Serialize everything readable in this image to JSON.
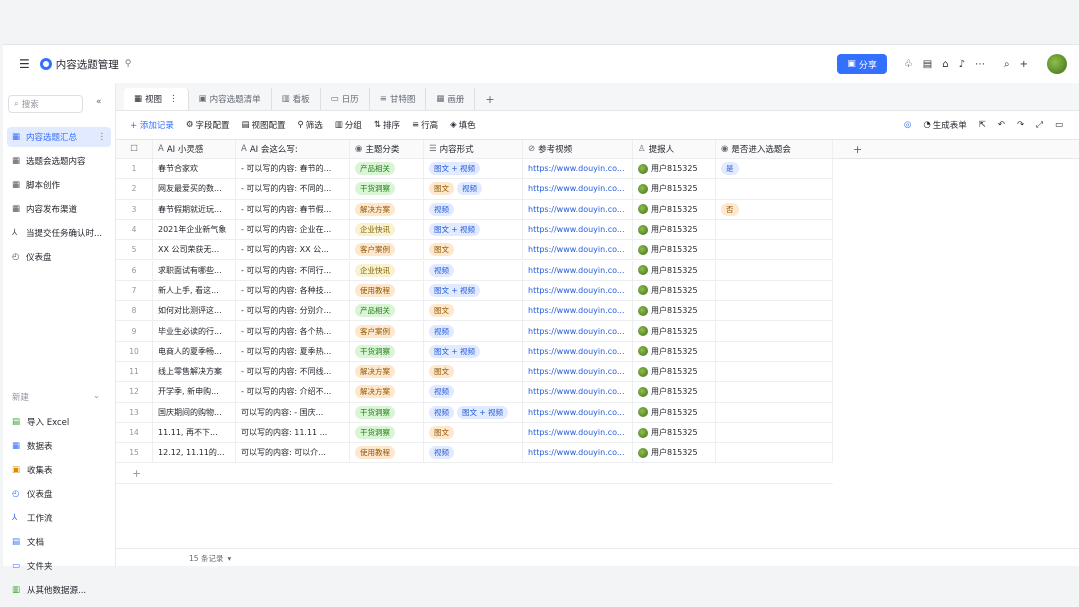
{
  "header": {
    "title": "内容选题管理",
    "share_label": "分享"
  },
  "sidebar": {
    "search_placeholder": "搜索",
    "items": [
      {
        "label": "内容选题汇总",
        "icon": "grid-icon",
        "active": true
      },
      {
        "label": "选题会选题内容",
        "icon": "grid-icon"
      },
      {
        "label": "脚本创作",
        "icon": "grid-icon"
      },
      {
        "label": "内容发布渠道",
        "icon": "grid-icon"
      },
      {
        "label": "当提交任务确认时...",
        "icon": "workflow-icon"
      },
      {
        "label": "仪表盘",
        "icon": "dashboard-icon"
      }
    ],
    "new_header": "新建",
    "new_items": [
      {
        "label": "导入 Excel",
        "icon": "excel-icon",
        "color": "#2ea121"
      },
      {
        "label": "数据表",
        "icon": "table-icon",
        "color": "#3370ff"
      },
      {
        "label": "收集表",
        "icon": "form-icon",
        "color": "#de8c00"
      },
      {
        "label": "仪表盘",
        "icon": "dashboard-icon",
        "color": "#3370ff"
      },
      {
        "label": "工作流",
        "icon": "workflow-icon",
        "color": "#3370ff"
      },
      {
        "label": "文档",
        "icon": "doc-icon",
        "color": "#3370ff"
      },
      {
        "label": "文件夹",
        "icon": "folder-icon",
        "color": "#3370ff"
      },
      {
        "label": "从其他数据源...",
        "icon": "datasource-icon",
        "color": "#2ea121"
      }
    ]
  },
  "tabs": [
    {
      "label": "视图",
      "icon": "grid-icon",
      "active": true
    },
    {
      "label": "内容选题清单",
      "icon": "form-icon"
    },
    {
      "label": "看板",
      "icon": "kanban-icon"
    },
    {
      "label": "日历",
      "icon": "calendar-icon"
    },
    {
      "label": "甘特图",
      "icon": "gantt-icon"
    },
    {
      "label": "画册",
      "icon": "gallery-icon"
    }
  ],
  "toolbar": {
    "add_record": "+ 添加记录",
    "tools": [
      "字段配置",
      "视图配置",
      "筛选",
      "分组",
      "排序",
      "行高",
      "填色"
    ],
    "generate_form": "生成表单"
  },
  "columns": [
    {
      "label": "",
      "icon": "checkbox-icon"
    },
    {
      "label": "AI 小灵感",
      "icon": "ai-icon"
    },
    {
      "label": "AI 会这么写:",
      "icon": "ai-icon"
    },
    {
      "label": "主题分类",
      "icon": "select-icon"
    },
    {
      "label": "内容形式",
      "icon": "multiselect-icon"
    },
    {
      "label": "参考视频",
      "icon": "link-icon"
    },
    {
      "label": "提报人",
      "icon": "person-icon"
    },
    {
      "label": "是否进入选题会",
      "icon": "select-icon"
    }
  ],
  "rows": [
    {
      "n": "1",
      "idea": "春节合家欢",
      "ai": "- 可以写的内容: 春节的...",
      "cat": "产品相关",
      "forms": [
        "图文 + 视频"
      ],
      "link": "https://www.douyin.co...",
      "person": "用户815325",
      "meeting": "是"
    },
    {
      "n": "2",
      "idea": "网友最爱买的数...",
      "ai": "- 可以写的内容: 不同的...",
      "cat": "干货洞察",
      "forms": [
        "图文",
        "视频"
      ],
      "link": "https://www.douyin.co...",
      "person": "用户815325",
      "meeting": ""
    },
    {
      "n": "3",
      "idea": "春节假期就近玩...",
      "ai": "- 可以写的内容: 春节假...",
      "cat": "解决方案",
      "forms": [
        "视频"
      ],
      "link": "https://www.douyin.co...",
      "person": "用户815325",
      "meeting": "否"
    },
    {
      "n": "4",
      "idea": "2021年企业新气象",
      "ai": "- 可以写的内容: 企业在...",
      "cat": "企业快讯",
      "forms": [
        "图文 + 视频"
      ],
      "link": "https://www.douyin.co...",
      "person": "用户815325",
      "meeting": ""
    },
    {
      "n": "5",
      "idea": "XX 公司荣获无...",
      "ai": "- 可以写的内容: XX 公...",
      "cat": "客户案例",
      "forms": [
        "图文"
      ],
      "link": "https://www.douyin.co...",
      "person": "用户815325",
      "meeting": ""
    },
    {
      "n": "6",
      "idea": "求职面试有哪些...",
      "ai": "- 可以写的内容: 不同行...",
      "cat": "企业快讯",
      "forms": [
        "视频"
      ],
      "link": "https://www.douyin.co...",
      "person": "用户815325",
      "meeting": ""
    },
    {
      "n": "7",
      "idea": "新人上手, 看这...",
      "ai": "- 可以写的内容: 各种技...",
      "cat": "使用教程",
      "forms": [
        "图文 + 视频"
      ],
      "link": "https://www.douyin.co...",
      "person": "用户815325",
      "meeting": ""
    },
    {
      "n": "8",
      "idea": "如何对比测评这...",
      "ai": "- 可以写的内容: 分别介...",
      "cat": "产品相关",
      "forms": [
        "图文"
      ],
      "link": "https://www.douyin.co...",
      "person": "用户815325",
      "meeting": ""
    },
    {
      "n": "9",
      "idea": "毕业生必读的行...",
      "ai": "- 可以写的内容: 各个热...",
      "cat": "客户案例",
      "forms": [
        "视频"
      ],
      "link": "https://www.douyin.co...",
      "person": "用户815325",
      "meeting": ""
    },
    {
      "n": "10",
      "idea": "电商人的夏季畅...",
      "ai": "- 可以写的内容: 夏季热...",
      "cat": "干货洞察",
      "forms": [
        "图文 + 视频"
      ],
      "link": "https://www.douyin.co...",
      "person": "用户815325",
      "meeting": ""
    },
    {
      "n": "11",
      "idea": "线上零售解决方案",
      "ai": "- 可以写的内容: 不同线...",
      "cat": "解决方案",
      "forms": [
        "图文"
      ],
      "link": "https://www.douyin.co...",
      "person": "用户815325",
      "meeting": ""
    },
    {
      "n": "12",
      "idea": "开学季, 新申购...",
      "ai": "- 可以写的内容: 介绍不...",
      "cat": "解决方案",
      "forms": [
        "视频"
      ],
      "link": "https://www.douyin.co...",
      "person": "用户815325",
      "meeting": ""
    },
    {
      "n": "13",
      "idea": "国庆期间的购物...",
      "ai": "可以写的内容: - 国庆...",
      "cat": "干货洞察",
      "forms": [
        "视频",
        "图文 + 视频"
      ],
      "link": "https://www.douyin.co...",
      "person": "用户815325",
      "meeting": ""
    },
    {
      "n": "14",
      "idea": "11.11, 再不下...",
      "ai": "可以写的内容: 11.11 ...",
      "cat": "干货洞察",
      "forms": [
        "图文"
      ],
      "link": "https://www.douyin.co...",
      "person": "用户815325",
      "meeting": ""
    },
    {
      "n": "15",
      "idea": "12.12, 11.11的...",
      "ai": "可以写的内容: 可以介...",
      "cat": "使用教程",
      "forms": [
        "视频"
      ],
      "link": "https://www.douyin.co...",
      "person": "用户815325",
      "meeting": ""
    }
  ],
  "tag_colors": {
    "产品相关": {
      "bg": "#d9f5d6",
      "fg": "#237b19"
    },
    "干货洞察": {
      "bg": "#d9f5d6",
      "fg": "#237b19"
    },
    "解决方案": {
      "bg": "#fee7cd",
      "fg": "#8f5a07"
    },
    "企业快讯": {
      "bg": "#faf1d1",
      "fg": "#7a6200"
    },
    "客户案例": {
      "bg": "#fee7cd",
      "fg": "#8f5a07"
    },
    "使用教程": {
      "bg": "#fee7cd",
      "fg": "#8f5a07"
    },
    "图文 + 视频": {
      "bg": "#e1eaff",
      "fg": "#245bdb"
    },
    "图文": {
      "bg": "#fee7cd",
      "fg": "#8f5a07"
    },
    "视频": {
      "bg": "#e1eaff",
      "fg": "#245bdb"
    },
    "是": {
      "bg": "#e1eaff",
      "fg": "#245bdb"
    },
    "否": {
      "bg": "#fee7cd",
      "fg": "#8f5a07"
    }
  },
  "footer": {
    "record_count": "15 条记录"
  }
}
